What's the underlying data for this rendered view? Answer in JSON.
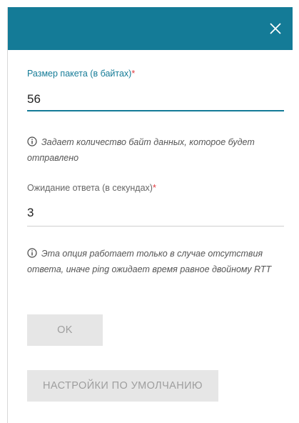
{
  "dialog": {
    "close_icon": "close-icon",
    "header_color": "#147b97"
  },
  "packet_size": {
    "label": "Размер пакета (в байтах)",
    "required_mark": "*",
    "value": "56",
    "hint": "Задает количество байт данных, которое будет отправлено",
    "hint_icon": "info-icon"
  },
  "response_timeout": {
    "label": "Ожидание ответа (в секундах)",
    "required_mark": "*",
    "value": "3",
    "hint": "Эта опция работает только в случае отсутствия ответа, иначе ping ожидает время равное двойному RTT",
    "hint_icon": "info-icon"
  },
  "buttons": {
    "ok_label": "OK",
    "defaults_label": "НАСТРОЙКИ ПО УМОЛЧАНИЮ"
  },
  "colors": {
    "accent": "#147b97",
    "required": "#e0393e",
    "disabled_button_bg": "#e6e6e6",
    "disabled_button_text": "#9e9e9e"
  }
}
